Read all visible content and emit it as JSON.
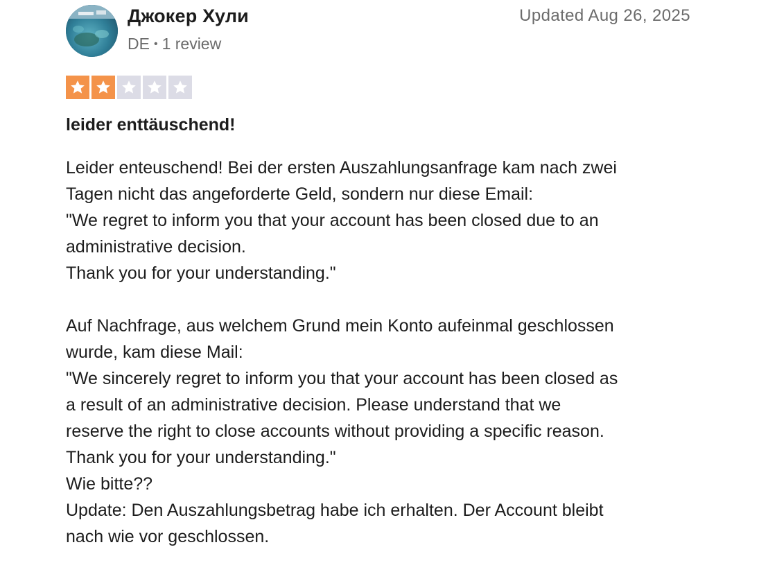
{
  "reviewer": {
    "name": "Джокер Хули",
    "country": "DE",
    "separator": "•",
    "review_count": "1 review"
  },
  "review": {
    "date": "Updated Aug 26, 2025",
    "rating": 2,
    "max_rating": 5,
    "title": "leider enttäuschend!",
    "body_lines": [
      "Leider enteuschend! Bei der ersten Auszahlungsanfrage kam nach zwei",
      "Tagen nicht das angeforderte Geld, sondern nur diese Email:",
      "\"We regret to inform you that your account has been closed due to an",
      "administrative decision.",
      "Thank you for your understanding.\"",
      "",
      "Auf Nachfrage, aus welchem Grund mein Konto aufeinmal geschlossen",
      "wurde, kam diese Mail:",
      "\"We sincerely regret to inform you that your account has been closed as",
      "a result of an administrative decision. Please understand that we",
      "reserve the right to close accounts without providing a specific reason.",
      "Thank you for your understanding.\"",
      "Wie bitte??",
      "Update: Den Auszahlungsbetrag habe ich erhalten. Der Account bleibt",
      "nach wie vor geschlossen."
    ]
  },
  "colors": {
    "star_filled": "#f4934a",
    "star_empty": "#dcdce6",
    "text_primary": "#1c1c1c",
    "text_secondary": "#6b6b6b"
  },
  "icons": {
    "star": "star-icon",
    "avatar": "avatar-photo"
  }
}
